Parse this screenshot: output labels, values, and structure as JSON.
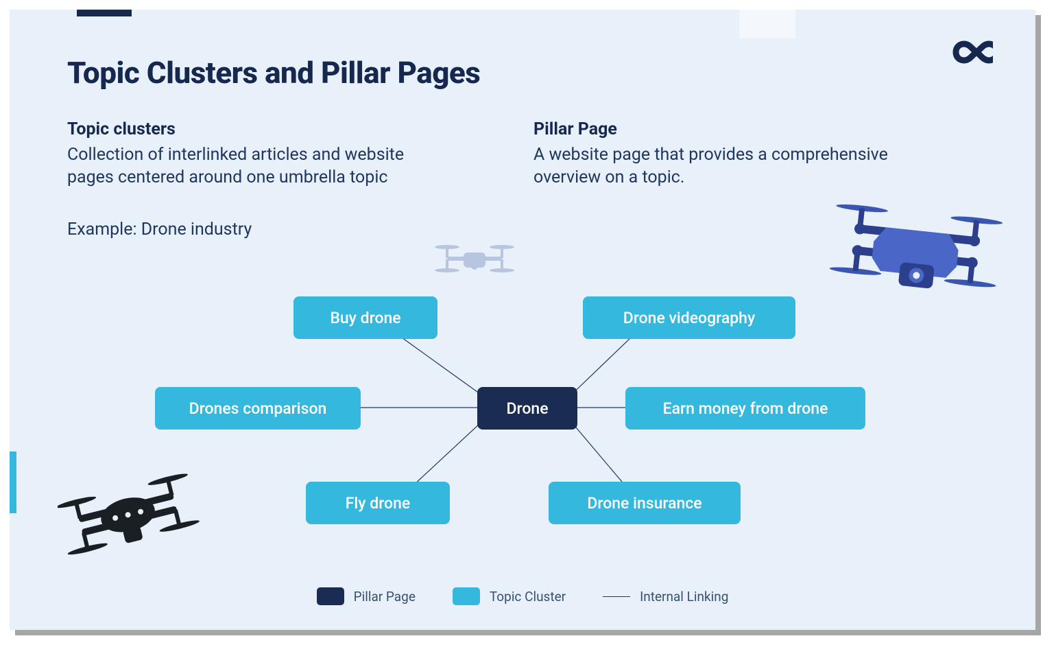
{
  "title": "Topic Clusters and Pillar Pages",
  "left": {
    "heading": "Topic clusters",
    "body": "Collection of interlinked articles and website pages centered around one umbrella topic"
  },
  "right": {
    "heading": "Pillar Page",
    "body": "A website page that provides a comprehensive overview on a topic."
  },
  "example": "Example: Drone industry",
  "diagram": {
    "center": "Drone",
    "clusters": [
      "Buy drone",
      "Drones comparison",
      "Fly drone",
      "Drone videography",
      "Earn money from drone",
      "Drone insurance"
    ]
  },
  "legend": {
    "pillar": "Pillar Page",
    "cluster": "Topic Cluster",
    "link": "Internal Linking"
  },
  "colors": {
    "bg": "#e8f0f9",
    "navy": "#16284e",
    "cyan": "#34b8dd",
    "text": "#20365e"
  }
}
